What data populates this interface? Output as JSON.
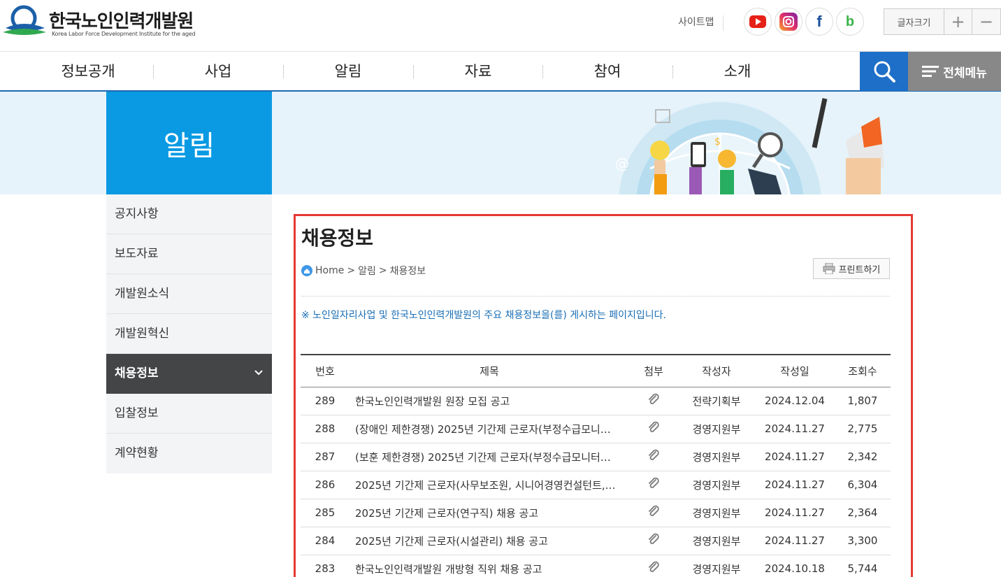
{
  "header": {
    "logo_text": "한국노인인력개발원",
    "logo_sub": "Korea Labor Force Development Institute for the aged",
    "sitemap": "사이트맵",
    "font_size_label": "글자크기",
    "font_plus": "+",
    "font_minus": "−",
    "sns": [
      "youtube-icon",
      "instagram-icon",
      "facebook-icon",
      "blog-icon"
    ]
  },
  "gnb": {
    "items": [
      "정보공개",
      "사업",
      "알림",
      "자료",
      "참여",
      "소개"
    ],
    "all_menu": "전체메뉴"
  },
  "section_title": "알림",
  "lnb": [
    {
      "label": "공지사항"
    },
    {
      "label": "보도자료"
    },
    {
      "label": "개발원소식"
    },
    {
      "label": "개발원혁신"
    },
    {
      "label": "채용정보",
      "active": true
    },
    {
      "label": "입찰정보"
    },
    {
      "label": "계약현황"
    }
  ],
  "main": {
    "title": "채용정보",
    "breadcrumb": [
      "Home",
      "알림",
      "채용정보"
    ],
    "breadcrumb_sep": ">",
    "print_label": "프린트하기",
    "notice": "※ 노인일자리사업 및 한국노인인력개발원의 주요 채용정보을(를) 게시하는 페이지입니다.",
    "columns": [
      "번호",
      "제목",
      "첨부",
      "작성자",
      "작성일",
      "조회수"
    ],
    "rows": [
      {
        "no": "289",
        "title": "한국노인인력개발원 원장 모집 공고",
        "author": "전략기획부",
        "date": "2024.12.04",
        "views": "1,807"
      },
      {
        "no": "288",
        "title": "(장애인 제한경쟁) 2025년 기간제 근로자(부정수급모니…",
        "author": "경영지원부",
        "date": "2024.11.27",
        "views": "2,775"
      },
      {
        "no": "287",
        "title": "(보훈 제한경쟁) 2025년 기간제 근로자(부정수급모니터…",
        "author": "경영지원부",
        "date": "2024.11.27",
        "views": "2,342"
      },
      {
        "no": "286",
        "title": "2025년 기간제 근로자(사무보조원, 시니어경영컨설턴트,…",
        "author": "경영지원부",
        "date": "2024.11.27",
        "views": "6,304"
      },
      {
        "no": "285",
        "title": "2025년 기간제 근로자(연구직) 채용 공고",
        "author": "경영지원부",
        "date": "2024.11.27",
        "views": "2,364"
      },
      {
        "no": "284",
        "title": "2025년 기간제 근로자(시설관리) 채용 공고",
        "author": "경영지원부",
        "date": "2024.11.27",
        "views": "3,300"
      },
      {
        "no": "283",
        "title": "한국노인인력개발원 개방형 직위 채용 공고",
        "author": "경영지원부",
        "date": "2024.10.18",
        "views": "5,744"
      }
    ]
  },
  "colors": {
    "accent": "#0a9ae3",
    "nav_blue": "#1d6fc8",
    "highlight": "#e53935",
    "lnb_active": "#434547"
  }
}
